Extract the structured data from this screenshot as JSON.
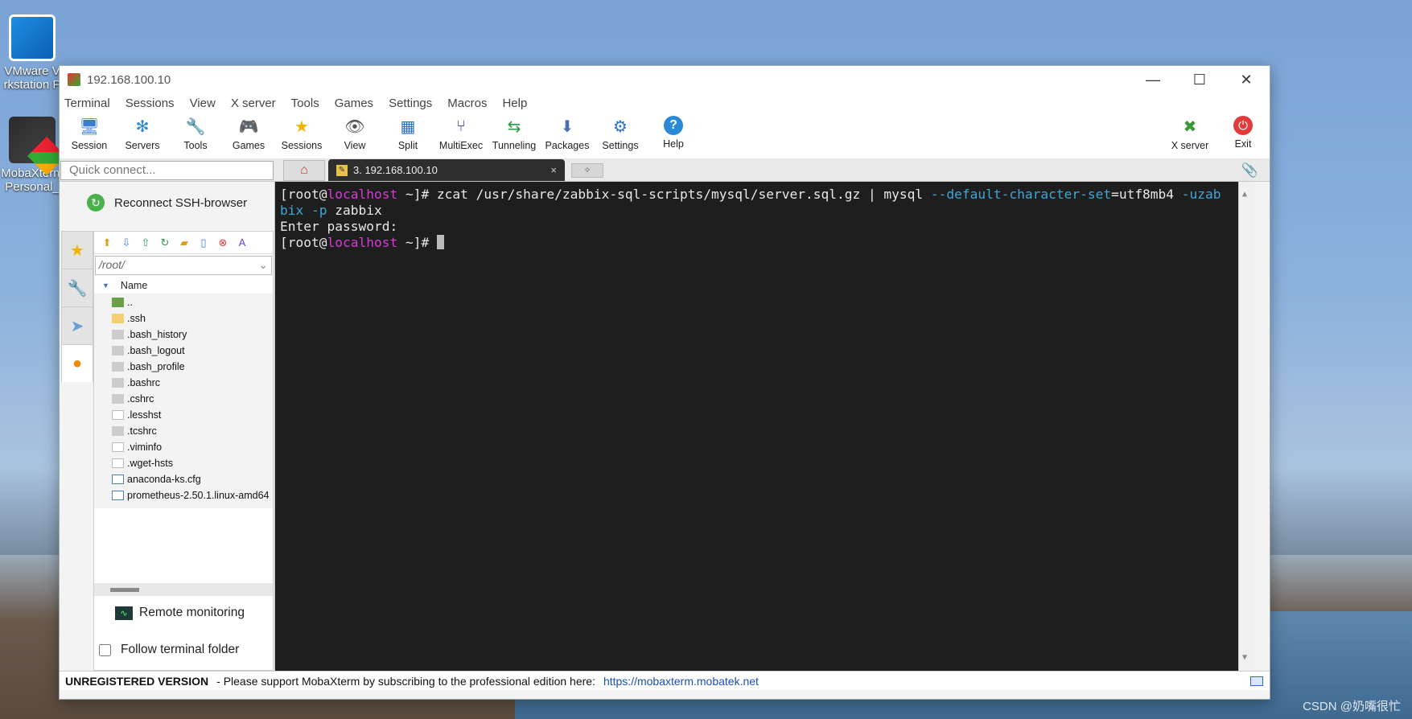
{
  "desktop": {
    "icons": [
      {
        "label": "VMware V\nrkstation P"
      },
      {
        "label": "MobaXterm\nPersonal_"
      }
    ],
    "watermark": "CSDN @奶嘴很忙"
  },
  "window": {
    "title": "192.168.100.10",
    "controls": {
      "minimize": "—",
      "maximize": "☐",
      "close": "✕"
    }
  },
  "menubar": {
    "items": [
      "Terminal",
      "Sessions",
      "View",
      "X server",
      "Tools",
      "Games",
      "Settings",
      "Macros",
      "Help"
    ]
  },
  "toolbar": {
    "left": [
      {
        "label": "Session",
        "icon": "session-icon",
        "glyph": "🖥"
      },
      {
        "label": "Servers",
        "icon": "servers-icon",
        "glyph": "✻"
      },
      {
        "label": "Tools",
        "icon": "tools-icon",
        "glyph": "🔧"
      },
      {
        "label": "Games",
        "icon": "games-icon",
        "glyph": "🎮"
      },
      {
        "label": "Sessions",
        "icon": "sessions-icon",
        "glyph": "★"
      },
      {
        "label": "View",
        "icon": "view-icon",
        "glyph": "👁"
      },
      {
        "label": "Split",
        "icon": "split-icon",
        "glyph": "▦"
      },
      {
        "label": "MultiExec",
        "icon": "multiexec-icon",
        "glyph": "⑂"
      },
      {
        "label": "Tunneling",
        "icon": "tunneling-icon",
        "glyph": "⇆"
      },
      {
        "label": "Packages",
        "icon": "packages-icon",
        "glyph": "⬇"
      },
      {
        "label": "Settings",
        "icon": "settings-icon",
        "glyph": "⚙"
      },
      {
        "label": "Help",
        "icon": "help-icon",
        "glyph": "?"
      }
    ],
    "right": [
      {
        "label": "X server",
        "icon": "xserver-icon",
        "glyph": "✖"
      },
      {
        "label": "Exit",
        "icon": "exit-icon",
        "glyph": "⏻"
      }
    ]
  },
  "tabs": {
    "quick_connect_placeholder": "Quick connect...",
    "session_tab_label": "3. 192.168.100.10",
    "close_glyph": "×"
  },
  "sidebar": {
    "reconnect_label": "Reconnect SSH-browser",
    "path": "/root/",
    "column_name": "Name",
    "files": [
      {
        "name": "..",
        "type": "up"
      },
      {
        "name": ".ssh",
        "type": "folder"
      },
      {
        "name": ".bash_history",
        "type": "file"
      },
      {
        "name": ".bash_logout",
        "type": "file"
      },
      {
        "name": ".bash_profile",
        "type": "file"
      },
      {
        "name": ".bashrc",
        "type": "file"
      },
      {
        "name": ".cshrc",
        "type": "file"
      },
      {
        "name": ".lesshst",
        "type": "doc"
      },
      {
        "name": ".tcshrc",
        "type": "file"
      },
      {
        "name": ".viminfo",
        "type": "doc"
      },
      {
        "name": ".wget-hsts",
        "type": "doc"
      },
      {
        "name": "anaconda-ks.cfg",
        "type": "cfg"
      },
      {
        "name": "prometheus-2.50.1.linux-amd64",
        "type": "cfg"
      }
    ],
    "remote_monitoring_label": "Remote monitoring",
    "follow_folder_label": "Follow terminal folder"
  },
  "terminal": {
    "line1_prefix": "[root@",
    "host": "localhost",
    "line1_cmd": " ~]# zcat /usr/share/zabbix-sql-scripts/mysql/server.sql.gz | mysql ",
    "opt1": "--default-character-set",
    "line1_after_opt": "=utf8mb4 ",
    "opt2a": "-uzab",
    "opt2b": "bix",
    "opt3": " -p",
    "line2_tail": " zabbix",
    "line3": "Enter password:",
    "line4_prompt_tail": " ~]# "
  },
  "statusbar": {
    "unregistered": "UNREGISTERED VERSION",
    "message": "-  Please support MobaXterm by subscribing to the professional edition here:",
    "link": "https://mobaxterm.mobatek.net"
  }
}
